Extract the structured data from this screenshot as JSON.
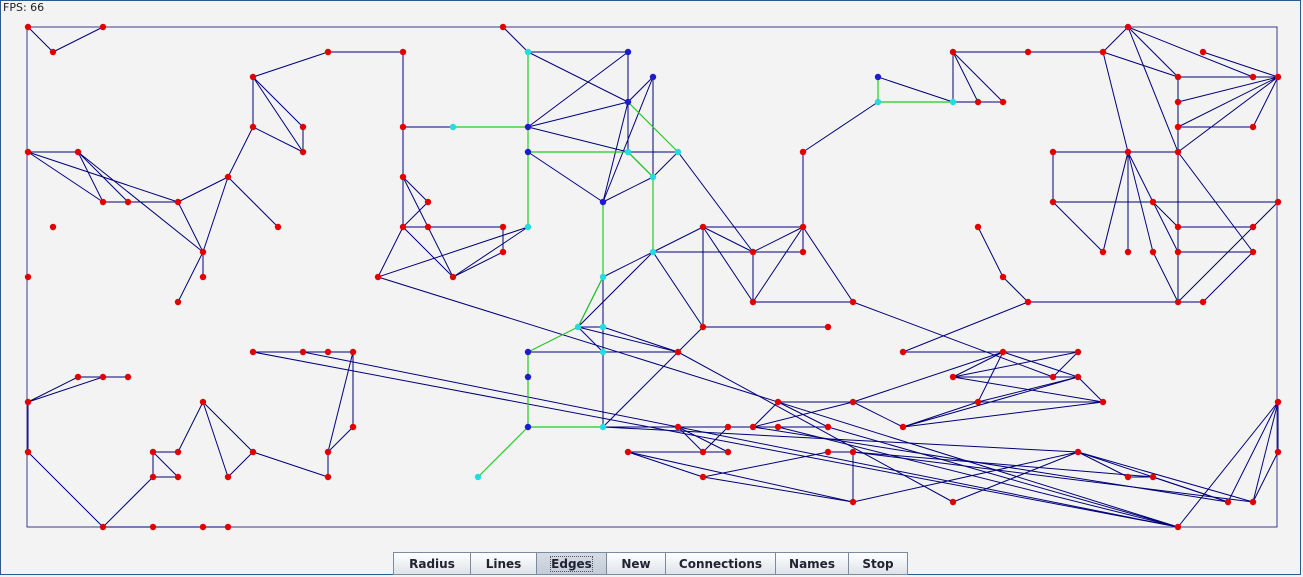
{
  "fps_label": "FPS: 66",
  "colors": {
    "border": "#3b3b8f",
    "edge": "#00007a",
    "path": "#22cc22",
    "node_red": "#e00000",
    "node_blue": "#1c1ccc",
    "node_cyan": "#22dddd"
  },
  "toolbar": {
    "buttons": [
      {
        "id": "radius",
        "label": "Radius"
      },
      {
        "id": "lines",
        "label": "Lines"
      },
      {
        "id": "edges",
        "label": "Edges",
        "pressed": true
      },
      {
        "id": "new",
        "label": "New"
      },
      {
        "id": "connections",
        "label": "Connections"
      },
      {
        "id": "names",
        "label": "Names"
      },
      {
        "id": "stop",
        "label": "Stop"
      }
    ]
  },
  "graph": {
    "nodes": [
      [
        28,
        27,
        "r"
      ],
      [
        53,
        52,
        "r"
      ],
      [
        103,
        27,
        "r"
      ],
      [
        28,
        152,
        "r"
      ],
      [
        78,
        152,
        "r"
      ],
      [
        103,
        202,
        "r"
      ],
      [
        128,
        202,
        "r"
      ],
      [
        178,
        202,
        "r"
      ],
      [
        53,
        227,
        "r"
      ],
      [
        28,
        277,
        "r"
      ],
      [
        203,
        252,
        "r"
      ],
      [
        203,
        277,
        "r"
      ],
      [
        178,
        302,
        "r"
      ],
      [
        228,
        177,
        "r"
      ],
      [
        253,
        127,
        "r"
      ],
      [
        253,
        77,
        "r"
      ],
      [
        303,
        127,
        "r"
      ],
      [
        303,
        152,
        "r"
      ],
      [
        278,
        227,
        "r"
      ],
      [
        328,
        52,
        "r"
      ],
      [
        403,
        52,
        "r"
      ],
      [
        403,
        127,
        "r"
      ],
      [
        403,
        177,
        "r"
      ],
      [
        428,
        202,
        "r"
      ],
      [
        403,
        227,
        "r"
      ],
      [
        428,
        227,
        "r"
      ],
      [
        453,
        127,
        "c"
      ],
      [
        503,
        227,
        "r"
      ],
      [
        503,
        252,
        "r"
      ],
      [
        453,
        277,
        "r"
      ],
      [
        378,
        277,
        "r"
      ],
      [
        528,
        227,
        "c"
      ],
      [
        503,
        27,
        "r"
      ],
      [
        528,
        52,
        "c"
      ],
      [
        628,
        52,
        "b"
      ],
      [
        653,
        77,
        "b"
      ],
      [
        628,
        102,
        "b"
      ],
      [
        528,
        127,
        "b"
      ],
      [
        528,
        152,
        "b"
      ],
      [
        628,
        152,
        "c"
      ],
      [
        678,
        152,
        "c"
      ],
      [
        653,
        177,
        "c"
      ],
      [
        603,
        202,
        "b"
      ],
      [
        653,
        252,
        "c"
      ],
      [
        603,
        277,
        "c"
      ],
      [
        578,
        327,
        "c"
      ],
      [
        603,
        327,
        "c"
      ],
      [
        603,
        352,
        "c"
      ],
      [
        528,
        352,
        "b"
      ],
      [
        528,
        377,
        "b"
      ],
      [
        528,
        427,
        "b"
      ],
      [
        478,
        477,
        "c"
      ],
      [
        603,
        427,
        "c"
      ],
      [
        678,
        352,
        "r"
      ],
      [
        703,
        327,
        "r"
      ],
      [
        703,
        227,
        "r"
      ],
      [
        753,
        252,
        "r"
      ],
      [
        803,
        227,
        "r"
      ],
      [
        803,
        252,
        "r"
      ],
      [
        753,
        302,
        "r"
      ],
      [
        853,
        302,
        "r"
      ],
      [
        828,
        327,
        "r"
      ],
      [
        803,
        152,
        "r"
      ],
      [
        878,
        102,
        "c"
      ],
      [
        878,
        77,
        "b"
      ],
      [
        953,
        102,
        "c"
      ],
      [
        953,
        52,
        "r"
      ],
      [
        978,
        102,
        "r"
      ],
      [
        1003,
        102,
        "r"
      ],
      [
        1028,
        52,
        "r"
      ],
      [
        1103,
        52,
        "r"
      ],
      [
        1128,
        27,
        "r"
      ],
      [
        1178,
        77,
        "r"
      ],
      [
        1203,
        52,
        "r"
      ],
      [
        1253,
        77,
        "r"
      ],
      [
        1278,
        77,
        "r"
      ],
      [
        1178,
        102,
        "r"
      ],
      [
        1178,
        127,
        "r"
      ],
      [
        1253,
        127,
        "r"
      ],
      [
        1178,
        152,
        "r"
      ],
      [
        1128,
        152,
        "r"
      ],
      [
        1053,
        152,
        "r"
      ],
      [
        1053,
        202,
        "r"
      ],
      [
        1153,
        202,
        "r"
      ],
      [
        1278,
        202,
        "r"
      ],
      [
        1178,
        227,
        "r"
      ],
      [
        1253,
        227,
        "r"
      ],
      [
        1103,
        252,
        "r"
      ],
      [
        1128,
        252,
        "r"
      ],
      [
        1153,
        252,
        "r"
      ],
      [
        1178,
        252,
        "r"
      ],
      [
        1253,
        252,
        "r"
      ],
      [
        1178,
        302,
        "r"
      ],
      [
        1203,
        302,
        "r"
      ],
      [
        978,
        227,
        "r"
      ],
      [
        1003,
        277,
        "r"
      ],
      [
        1028,
        302,
        "r"
      ],
      [
        903,
        352,
        "r"
      ],
      [
        1003,
        352,
        "r"
      ],
      [
        1078,
        352,
        "r"
      ],
      [
        953,
        377,
        "r"
      ],
      [
        1053,
        377,
        "r"
      ],
      [
        1078,
        377,
        "r"
      ],
      [
        978,
        402,
        "r"
      ],
      [
        1103,
        402,
        "r"
      ],
      [
        903,
        427,
        "r"
      ],
      [
        853,
        402,
        "r"
      ],
      [
        778,
        402,
        "r"
      ],
      [
        753,
        427,
        "r"
      ],
      [
        828,
        427,
        "r"
      ],
      [
        778,
        427,
        "r"
      ],
      [
        728,
        427,
        "r"
      ],
      [
        678,
        427,
        "r"
      ],
      [
        703,
        452,
        "r"
      ],
      [
        728,
        452,
        "r"
      ],
      [
        628,
        452,
        "r"
      ],
      [
        703,
        477,
        "r"
      ],
      [
        828,
        452,
        "r"
      ],
      [
        853,
        452,
        "r"
      ],
      [
        853,
        502,
        "r"
      ],
      [
        953,
        502,
        "r"
      ],
      [
        1078,
        452,
        "r"
      ],
      [
        1128,
        477,
        "r"
      ],
      [
        1153,
        477,
        "r"
      ],
      [
        1228,
        502,
        "r"
      ],
      [
        1253,
        502,
        "r"
      ],
      [
        1278,
        452,
        "r"
      ],
      [
        1278,
        402,
        "r"
      ],
      [
        1178,
        527,
        "r"
      ],
      [
        253,
        352,
        "r"
      ],
      [
        303,
        352,
        "r"
      ],
      [
        328,
        352,
        "r"
      ],
      [
        353,
        352,
        "r"
      ],
      [
        353,
        427,
        "r"
      ],
      [
        328,
        452,
        "r"
      ],
      [
        328,
        477,
        "r"
      ],
      [
        253,
        452,
        "r"
      ],
      [
        228,
        477,
        "r"
      ],
      [
        203,
        402,
        "r"
      ],
      [
        178,
        452,
        "r"
      ],
      [
        153,
        452,
        "r"
      ],
      [
        153,
        477,
        "r"
      ],
      [
        178,
        477,
        "r"
      ],
      [
        128,
        377,
        "r"
      ],
      [
        103,
        377,
        "r"
      ],
      [
        78,
        377,
        "r"
      ],
      [
        28,
        402,
        "r"
      ],
      [
        28,
        452,
        "r"
      ],
      [
        103,
        527,
        "r"
      ],
      [
        153,
        527,
        "r"
      ],
      [
        203,
        527,
        "r"
      ],
      [
        228,
        527,
        "r"
      ]
    ],
    "edges": [
      [
        0,
        1
      ],
      [
        1,
        2
      ],
      [
        3,
        4
      ],
      [
        4,
        5
      ],
      [
        4,
        6
      ],
      [
        5,
        6
      ],
      [
        6,
        7
      ],
      [
        3,
        7
      ],
      [
        3,
        5
      ],
      [
        4,
        10
      ],
      [
        7,
        10
      ],
      [
        10,
        11
      ],
      [
        10,
        12
      ],
      [
        7,
        13
      ],
      [
        13,
        10
      ],
      [
        13,
        14
      ],
      [
        13,
        18
      ],
      [
        14,
        15
      ],
      [
        15,
        16
      ],
      [
        14,
        17
      ],
      [
        15,
        17
      ],
      [
        16,
        17
      ],
      [
        15,
        19
      ],
      [
        19,
        20
      ],
      [
        20,
        21
      ],
      [
        21,
        22
      ],
      [
        21,
        26
      ],
      [
        22,
        23
      ],
      [
        22,
        24
      ],
      [
        22,
        25
      ],
      [
        23,
        24
      ],
      [
        24,
        25
      ],
      [
        24,
        29
      ],
      [
        25,
        29
      ],
      [
        25,
        27
      ],
      [
        27,
        28
      ],
      [
        28,
        29
      ],
      [
        29,
        31
      ],
      [
        24,
        30
      ],
      [
        30,
        31
      ],
      [
        30,
        128
      ],
      [
        24,
        27
      ],
      [
        32,
        33
      ],
      [
        33,
        34
      ],
      [
        33,
        36
      ],
      [
        33,
        37
      ],
      [
        34,
        36
      ],
      [
        35,
        36
      ],
      [
        35,
        41
      ],
      [
        34,
        37
      ],
      [
        36,
        37
      ],
      [
        36,
        39
      ],
      [
        36,
        42
      ],
      [
        35,
        42
      ],
      [
        37,
        39
      ],
      [
        38,
        39
      ],
      [
        38,
        42
      ],
      [
        39,
        41
      ],
      [
        40,
        41
      ],
      [
        39,
        40
      ],
      [
        41,
        42
      ],
      [
        41,
        43
      ],
      [
        42,
        44
      ],
      [
        43,
        44
      ],
      [
        44,
        45
      ],
      [
        43,
        45
      ],
      [
        43,
        54
      ],
      [
        44,
        46
      ],
      [
        45,
        47
      ],
      [
        45,
        46
      ],
      [
        46,
        47
      ],
      [
        46,
        53
      ],
      [
        45,
        53
      ],
      [
        47,
        53
      ],
      [
        47,
        52
      ],
      [
        48,
        47
      ],
      [
        52,
        53
      ],
      [
        52,
        121
      ],
      [
        53,
        120
      ],
      [
        53,
        54
      ],
      [
        54,
        55
      ],
      [
        55,
        56
      ],
      [
        55,
        57
      ],
      [
        56,
        57
      ],
      [
        56,
        58
      ],
      [
        57,
        58
      ],
      [
        56,
        59
      ],
      [
        57,
        59
      ],
      [
        59,
        60
      ],
      [
        55,
        59
      ],
      [
        57,
        60
      ],
      [
        43,
        55
      ],
      [
        43,
        58
      ],
      [
        40,
        56
      ],
      [
        57,
        62
      ],
      [
        62,
        63
      ],
      [
        63,
        64
      ],
      [
        64,
        65
      ],
      [
        65,
        66
      ],
      [
        65,
        67
      ],
      [
        66,
        67
      ],
      [
        66,
        68
      ],
      [
        67,
        68
      ],
      [
        66,
        69
      ],
      [
        69,
        70
      ],
      [
        70,
        71
      ],
      [
        71,
        72
      ],
      [
        70,
        72
      ],
      [
        71,
        74
      ],
      [
        72,
        76
      ],
      [
        72,
        77
      ],
      [
        72,
        75
      ],
      [
        73,
        75
      ],
      [
        74,
        75
      ],
      [
        75,
        76
      ],
      [
        75,
        77
      ],
      [
        75,
        78
      ],
      [
        75,
        79
      ],
      [
        76,
        77
      ],
      [
        77,
        78
      ],
      [
        76,
        79
      ],
      [
        71,
        79
      ],
      [
        70,
        80
      ],
      [
        79,
        80
      ],
      [
        80,
        81
      ],
      [
        81,
        82
      ],
      [
        82,
        83
      ],
      [
        80,
        83
      ],
      [
        83,
        84
      ],
      [
        83,
        85
      ],
      [
        85,
        86
      ],
      [
        80,
        87
      ],
      [
        82,
        87
      ],
      [
        80,
        88
      ],
      [
        80,
        89
      ],
      [
        79,
        90
      ],
      [
        79,
        91
      ],
      [
        83,
        90
      ],
      [
        85,
        90
      ],
      [
        90,
        91
      ],
      [
        89,
        92
      ],
      [
        90,
        92
      ],
      [
        92,
        93
      ],
      [
        91,
        93
      ],
      [
        84,
        92
      ],
      [
        94,
        95
      ],
      [
        95,
        96
      ],
      [
        96,
        97
      ],
      [
        92,
        96
      ],
      [
        97,
        98
      ],
      [
        97,
        99
      ],
      [
        98,
        99
      ],
      [
        99,
        100
      ],
      [
        99,
        101
      ],
      [
        98,
        102
      ],
      [
        98,
        103
      ],
      [
        100,
        102
      ],
      [
        102,
        104
      ],
      [
        103,
        104
      ],
      [
        100,
        104
      ],
      [
        102,
        105
      ],
      [
        103,
        105
      ],
      [
        104,
        106
      ],
      [
        98,
        106
      ],
      [
        105,
        106
      ],
      [
        106,
        107
      ],
      [
        106,
        108
      ],
      [
        107,
        108
      ],
      [
        107,
        109
      ],
      [
        108,
        110
      ],
      [
        109,
        111
      ],
      [
        110,
        112
      ],
      [
        111,
        112
      ],
      [
        112,
        113
      ],
      [
        113,
        114
      ],
      [
        114,
        115
      ],
      [
        115,
        116
      ],
      [
        116,
        117
      ],
      [
        117,
        118
      ],
      [
        116,
        119
      ],
      [
        118,
        119
      ],
      [
        115,
        119
      ],
      [
        119,
        121
      ],
      [
        120,
        121
      ],
      [
        121,
        122
      ],
      [
        122,
        123
      ],
      [
        118,
        125
      ],
      [
        125,
        126
      ],
      [
        126,
        127
      ],
      [
        109,
        128
      ],
      [
        110,
        128
      ],
      [
        124,
        108
      ],
      [
        129,
        130
      ],
      [
        130,
        131
      ],
      [
        131,
        132
      ],
      [
        132,
        133
      ],
      [
        132,
        134
      ],
      [
        133,
        134
      ],
      [
        134,
        135
      ],
      [
        135,
        136
      ],
      [
        136,
        137
      ],
      [
        136,
        138
      ],
      [
        137,
        138
      ],
      [
        138,
        139
      ],
      [
        139,
        140
      ],
      [
        140,
        141
      ],
      [
        141,
        142
      ],
      [
        140,
        142
      ],
      [
        143,
        144
      ],
      [
        143,
        145
      ],
      [
        144,
        145
      ],
      [
        145,
        146
      ],
      [
        144,
        146
      ],
      [
        146,
        147
      ],
      [
        147,
        148
      ],
      [
        148,
        149
      ],
      [
        149,
        150
      ],
      [
        150,
        151
      ],
      [
        151,
        152
      ],
      [
        152,
        153
      ],
      [
        153,
        154
      ],
      [
        154,
        155
      ],
      [
        141,
        148
      ],
      [
        139,
        152
      ],
      [
        127,
        128
      ],
      [
        128,
        129
      ],
      [
        128,
        130
      ],
      [
        52,
        110
      ],
      [
        110,
        111
      ],
      [
        110,
        112
      ],
      [
        111,
        113
      ],
      [
        112,
        114
      ],
      [
        54,
        61
      ],
      [
        60,
        101
      ],
      [
        102,
        103
      ],
      [
        104,
        105
      ],
      [
        98,
        100
      ],
      [
        127,
        124
      ],
      [
        123,
        124
      ],
      [
        118,
        123
      ],
      [
        121,
        125
      ],
      [
        121,
        124
      ],
      [
        125,
        127
      ]
    ],
    "path_edges": [
      [
        33,
        37
      ],
      [
        37,
        38
      ],
      [
        38,
        31
      ],
      [
        26,
        37
      ],
      [
        38,
        39
      ],
      [
        39,
        41
      ],
      [
        36,
        40
      ],
      [
        42,
        44
      ],
      [
        41,
        43
      ],
      [
        63,
        64
      ],
      [
        63,
        65
      ],
      [
        45,
        48
      ],
      [
        48,
        49
      ],
      [
        49,
        50
      ],
      [
        50,
        52
      ],
      [
        50,
        51
      ],
      [
        44,
        45
      ]
    ]
  }
}
